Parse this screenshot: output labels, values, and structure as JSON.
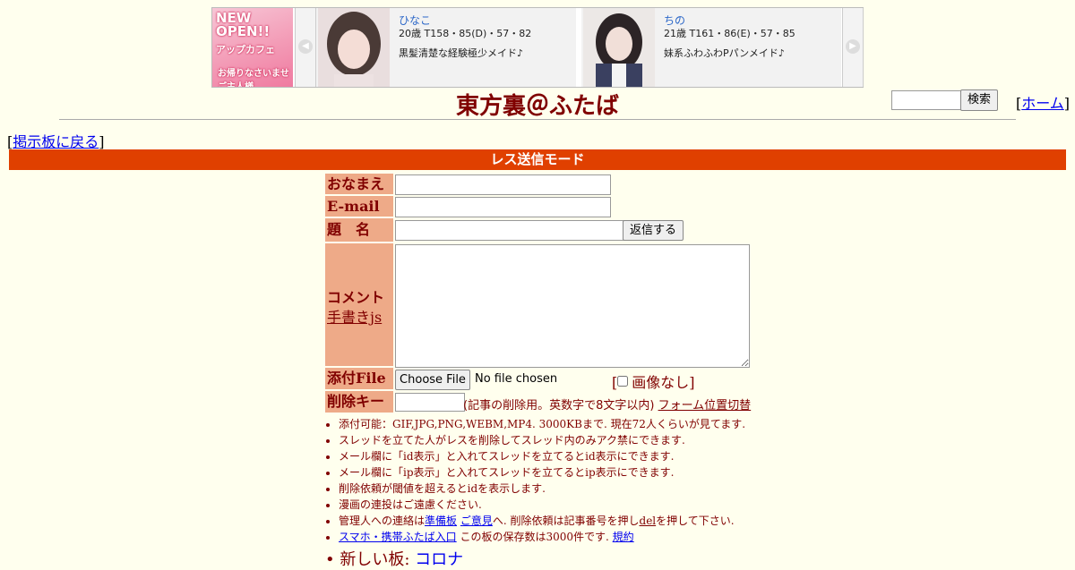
{
  "banner": {
    "ad": {
      "line1": "NEW OPEN!!",
      "line2": "アップカフェ",
      "line3": "お帰りなさいませご主人様"
    },
    "cards": [
      {
        "name": "ひなこ",
        "stats": "20歳 T158・85(D)・57・82",
        "desc": "黒髪清楚な経験極少メイド♪"
      },
      {
        "name": "ちの",
        "stats": "21歳 T161・86(E)・57・85",
        "desc": "妹系ふわふわPパンメイド♪"
      }
    ]
  },
  "header": {
    "title": "東方裏＠ふたば",
    "search_button": "検索",
    "home_open": "[",
    "home_label": "ホーム",
    "home_close": "]"
  },
  "nav": {
    "back_open": "[",
    "back_label": "掲示板に戻る",
    "back_close": "]"
  },
  "mode_bar": "レス送信モード",
  "form": {
    "name_label": "おなまえ",
    "email_label": "E-mail",
    "subject_label": "題　名",
    "submit_label": "返信する",
    "comment_label": "コメント",
    "handwrite_link": "手書きjs",
    "file_label": "添付File",
    "file_button": "Choose File",
    "file_status": "No file chosen",
    "no_image_open": "[",
    "no_image_label": "画像なし",
    "no_image_close": "]",
    "delkey_label": "削除キー",
    "delkey_note": "(記事の削除用。英数字で8文字以内)",
    "form_toggle": "フォーム位置切替"
  },
  "notes": {
    "n1": "添付可能：GIF,JPG,PNG,WEBM,MP4. 3000KBまで. 現在72人くらいが見てます.",
    "n2": "スレッドを立てた人がレスを削除してスレッド内のみアク禁にできます.",
    "n3": "メール欄に「id表示」と入れてスレッドを立てるとid表示にできます.",
    "n4": "メール欄に「ip表示」と入れてスレッドを立てるとip表示にできます.",
    "n5": "削除依頼が閾値を超えるとidを表示します.",
    "n6": "漫画の連投はご遠慮ください.",
    "n7_pre": "管理人への連絡は",
    "n7_link1": "準備板",
    "n7_link2": "ご意見",
    "n7_mid": "へ. 削除依頼は記事番号を押し",
    "n7_del": "del",
    "n7_post": "を押して下さい.",
    "n8_link": "スマホ・携帯ふたば入口",
    "n8_mid": "この板の保存数は3000件です.",
    "n8_rules": "規約"
  },
  "newboard": {
    "label": "新しい板:",
    "link": "コロナ"
  },
  "colors": {
    "background": "#ffffee",
    "text": "#800000",
    "label_bg": "#eeaa88",
    "mode_bar": "#e04000",
    "link": "#0000ee"
  }
}
